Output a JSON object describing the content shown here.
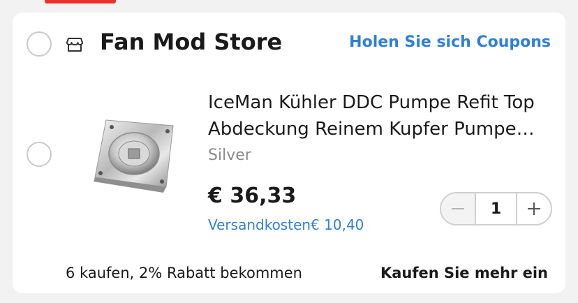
{
  "store": {
    "name": "Fan Mod Store",
    "coupon_link": "Holen Sie sich Coupons",
    "icon": "store-icon"
  },
  "item": {
    "title": "IceMan Kühler DDC Pumpe Refit Top Abdeckung Reinem Kupfer Pumpe Abdeckung",
    "variant": "Silver",
    "price": "€ 36,33",
    "shipping": "Versandkosten€ 10,40",
    "quantity": "1",
    "image": "copper-pump-top-cover"
  },
  "promo": {
    "text": "6 kaufen, 2% Rabatt bekommen",
    "link": "Kaufen Sie mehr ein"
  },
  "colors": {
    "accent_red": "#e8322a",
    "link_blue": "#2f7fd8",
    "text": "#1a1a1a",
    "muted": "#8a8a8a"
  }
}
